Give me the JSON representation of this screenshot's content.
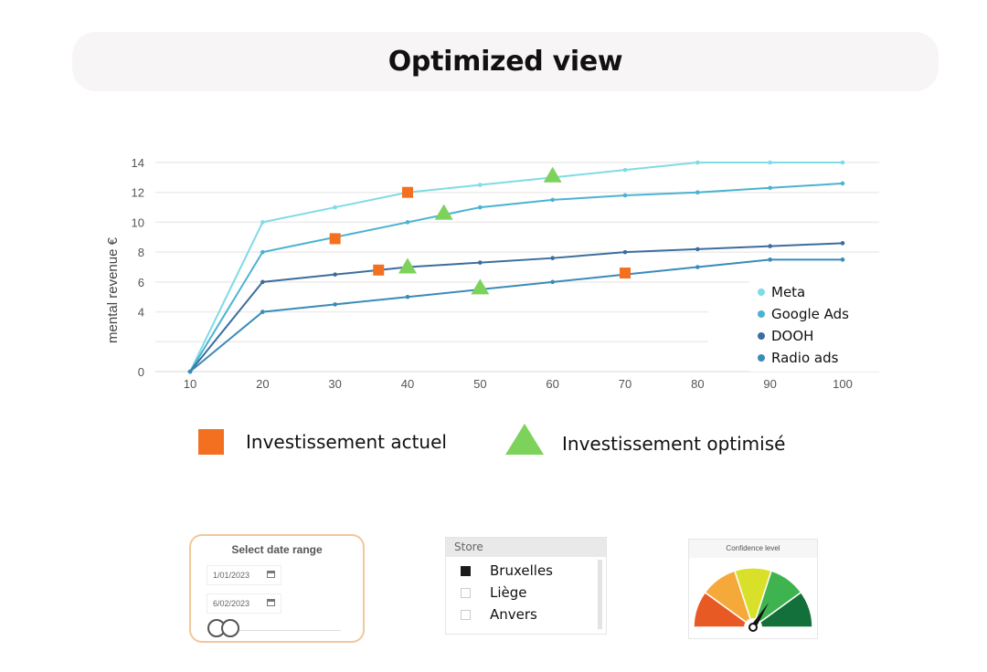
{
  "header": {
    "title": "Optimized view"
  },
  "chart_data": {
    "type": "line",
    "title": "",
    "xlabel": "",
    "ylabel": "Incremental revenue €",
    "ylabel_visible": "mental revenue €",
    "x": [
      10,
      20,
      30,
      40,
      50,
      60,
      70,
      80,
      90,
      100
    ],
    "x_tick_labels": [
      "10",
      "20",
      "30",
      "40",
      "50",
      "60",
      "70",
      "80",
      "90",
      "100"
    ],
    "y_tick_labels": [
      "0",
      "4",
      "6",
      "8",
      "10",
      "12",
      "14"
    ],
    "y_ticks": [
      0,
      4,
      6,
      8,
      10,
      12,
      14
    ],
    "gridlines": [
      0,
      2,
      4,
      6,
      8,
      10,
      12,
      14
    ],
    "ylim": [
      0,
      14
    ],
    "xlim": [
      10,
      100
    ],
    "grid": true,
    "legend_position": "bottom-right",
    "series": [
      {
        "name": "Meta",
        "color": "#7fdbe6",
        "values": [
          0,
          10,
          11,
          12,
          12.5,
          13,
          13.5,
          14,
          14,
          14
        ]
      },
      {
        "name": "Google Ads",
        "color": "#4ab3d1",
        "values": [
          0,
          8,
          9,
          10,
          11,
          11.5,
          11.8,
          12,
          12.3,
          12.6
        ]
      },
      {
        "name": "DOOH",
        "color": "#3d6d9e",
        "values": [
          0,
          6,
          6.5,
          7,
          7.3,
          7.6,
          8,
          8.2,
          8.4,
          8.6
        ]
      },
      {
        "name": "Radio ads",
        "color": "#3a8bb8",
        "values": [
          0,
          4,
          4.5,
          5,
          5.5,
          6,
          6.5,
          7,
          7.5,
          7.5
        ]
      }
    ],
    "markers": {
      "current": {
        "label": "Investissement actuel",
        "color": "#f37021",
        "shape": "square",
        "points": [
          {
            "series": "Meta",
            "x": 40,
            "y": 12
          },
          {
            "series": "Google Ads",
            "x": 30,
            "y": 8.9
          },
          {
            "series": "DOOH",
            "x": 36,
            "y": 6.8
          },
          {
            "series": "Radio ads",
            "x": 70,
            "y": 6.6
          }
        ]
      },
      "optimized": {
        "label": "Investissement optimisé",
        "color": "#7dd25c",
        "shape": "triangle",
        "points": [
          {
            "series": "Meta",
            "x": 60,
            "y": 13.1
          },
          {
            "series": "Google Ads",
            "x": 45,
            "y": 10.6
          },
          {
            "series": "DOOH",
            "x": 40,
            "y": 7.0
          },
          {
            "series": "Radio ads",
            "x": 50,
            "y": 5.6
          }
        ]
      }
    }
  },
  "marker_legend": {
    "current_label": "Investissement actuel",
    "optimized_label": "Investissement optimisé"
  },
  "date_range": {
    "title": "Select date range",
    "start": "1/01/2023",
    "end": "6/02/2023",
    "slider_start": 0,
    "slider_end": 0.05
  },
  "store_filter": {
    "title": "Store",
    "items": [
      {
        "label": "Bruxelles",
        "checked": true
      },
      {
        "label": "Liège",
        "checked": false
      },
      {
        "label": "Anvers",
        "checked": false
      }
    ]
  },
  "gauge": {
    "title": "Confidence level",
    "value_fraction": 0.68,
    "segments": [
      "#e85a24",
      "#f5a93a",
      "#d9e02a",
      "#3fb34f",
      "#14703a"
    ]
  }
}
